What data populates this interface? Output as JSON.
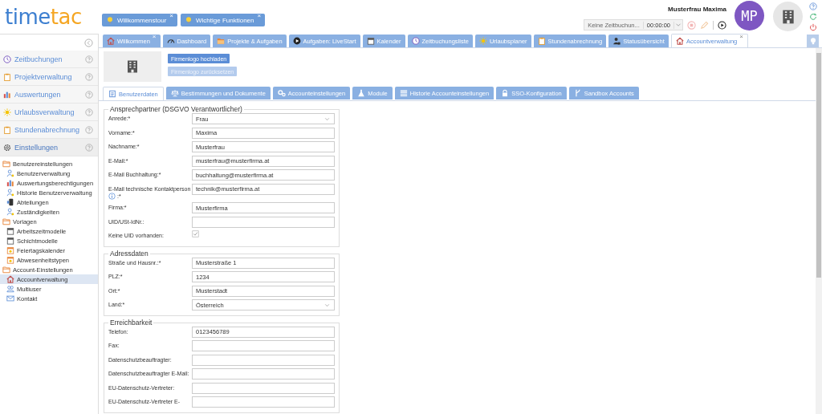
{
  "logo": {
    "part1": "time",
    "part2": "tac"
  },
  "tours": [
    {
      "label": "Willkommenstour",
      "close": "×"
    },
    {
      "label": "Wichtige Funktionen",
      "close": "×"
    }
  ],
  "user": {
    "name": "Musterfrau Maxima",
    "initials": "MP"
  },
  "timer": {
    "value": "Keine Zeitbuchun...",
    "time": "00:00:00"
  },
  "tabs": [
    {
      "label": "Willkommen",
      "selected": false,
      "close": "×"
    },
    {
      "label": "Dashboard",
      "selected": false
    },
    {
      "label": "Projekte & Aufgaben",
      "selected": false
    },
    {
      "label": "Aufgaben: LiveStart",
      "selected": false
    },
    {
      "label": "Kalender",
      "selected": false
    },
    {
      "label": "Zeitbuchungsliste",
      "selected": false
    },
    {
      "label": "Urlaubsplaner",
      "selected": false
    },
    {
      "label": "Stundenabrechnung",
      "selected": false
    },
    {
      "label": "Statusübersicht",
      "selected": false
    },
    {
      "label": "Accountverwaltung",
      "selected": true,
      "close": "×"
    }
  ],
  "sidebar": {
    "sections": [
      {
        "label": "Zeitbuchungen",
        "expanded": false
      },
      {
        "label": "Projektverwaltung",
        "expanded": false
      },
      {
        "label": "Auswertungen",
        "expanded": false
      },
      {
        "label": "Urlaubsverwaltung",
        "expanded": false
      },
      {
        "label": "Stundenabrechnung",
        "expanded": false
      },
      {
        "label": "Einstellungen",
        "expanded": true
      }
    ],
    "tree": [
      {
        "label": "Benutzereinstellungen",
        "children": [
          {
            "label": "Benutzerverwaltung",
            "selected": false
          },
          {
            "label": "Auswertungsberechtigungen",
            "selected": false
          },
          {
            "label": "Historie Benutzerverwaltung",
            "selected": false
          },
          {
            "label": "Abteilungen",
            "selected": false
          },
          {
            "label": "Zuständigkeiten",
            "selected": false
          }
        ]
      },
      {
        "label": "Vorlagen",
        "children": [
          {
            "label": "Arbeitszeitmodelle",
            "selected": false
          },
          {
            "label": "Schichtmodelle",
            "selected": false
          },
          {
            "label": "Feiertagskalender",
            "selected": false
          },
          {
            "label": "Abwesenheitstypen",
            "selected": false
          }
        ]
      },
      {
        "label": "Account-Einstellungen",
        "children": [
          {
            "label": "Accountverwaltung",
            "selected": true
          },
          {
            "label": "Multiuser",
            "selected": false
          },
          {
            "label": "Kontakt",
            "selected": false
          }
        ]
      }
    ]
  },
  "logo_buttons": [
    {
      "label": "Firmenlogo hochladen",
      "disabled": false
    },
    {
      "label": "Firmenlogo zurücksetzen",
      "disabled": true
    }
  ],
  "subtabs": [
    {
      "label": "Benutzerdaten",
      "selected": true
    },
    {
      "label": "Bestimmungen und Dokumente",
      "selected": false
    },
    {
      "label": "Accounteinstellungen",
      "selected": false
    },
    {
      "label": "Module",
      "selected": false
    },
    {
      "label": "Historie Accounteinstellungen",
      "selected": false
    },
    {
      "label": "SSO-Konfiguration",
      "selected": false
    },
    {
      "label": "Sandbox Accounts",
      "selected": false
    }
  ],
  "fieldsets": [
    {
      "legend": "Ansprechpartner (DSGVO Verantwortlicher)",
      "fields": [
        {
          "kind": "select",
          "label": "Anrede:*",
          "value": "Frau"
        },
        {
          "kind": "text",
          "label": "Vorname:*",
          "value": "Maxima"
        },
        {
          "kind": "text",
          "label": "Nachname:*",
          "value": "Musterfrau"
        },
        {
          "kind": "text",
          "label": "E-Mail:*",
          "value": "musterfrau@musterfirma.at"
        },
        {
          "kind": "text",
          "label": "E-Mail Buchhaltung:*",
          "value": "buchhaltung@musterfirma.at"
        },
        {
          "kind": "text",
          "label": "E-Mail technische Kontaktperson",
          "label_suffix": ":*",
          "info": true,
          "value": "technik@musterfirma.at"
        },
        {
          "kind": "text",
          "label": "Firma:*",
          "value": "Musterfirma"
        },
        {
          "kind": "text",
          "label": "UID/USt-IdNr.:"
        },
        {
          "kind": "checkbox",
          "label": "Keine UID vorhanden:",
          "checked": true
        }
      ]
    },
    {
      "legend": "Adressdaten",
      "fields": [
        {
          "kind": "text",
          "label": "Straße und Hausnr.:*",
          "value": "Musterstraße 1"
        },
        {
          "kind": "text",
          "label": "PLZ:*",
          "value": "1234"
        },
        {
          "kind": "text",
          "label": "Ort:*",
          "value": "Musterstadt"
        },
        {
          "kind": "select",
          "label": "Land:*",
          "value": "Österreich"
        }
      ]
    },
    {
      "legend": "Erreichbarkeit",
      "fields": [
        {
          "kind": "text",
          "label": "Telefon:",
          "value": "0123456789"
        },
        {
          "kind": "text",
          "label": "Fax:"
        },
        {
          "kind": "text",
          "label": "Datenschutzbeauftragter:"
        },
        {
          "kind": "text",
          "label": "Datenschutzbeauftragter E-Mail:"
        },
        {
          "kind": "text",
          "label": "EU-Datenschutz-Vertreter:"
        },
        {
          "kind": "text",
          "label": "EU-Datenschutz-Vertreter E-"
        }
      ]
    }
  ]
}
